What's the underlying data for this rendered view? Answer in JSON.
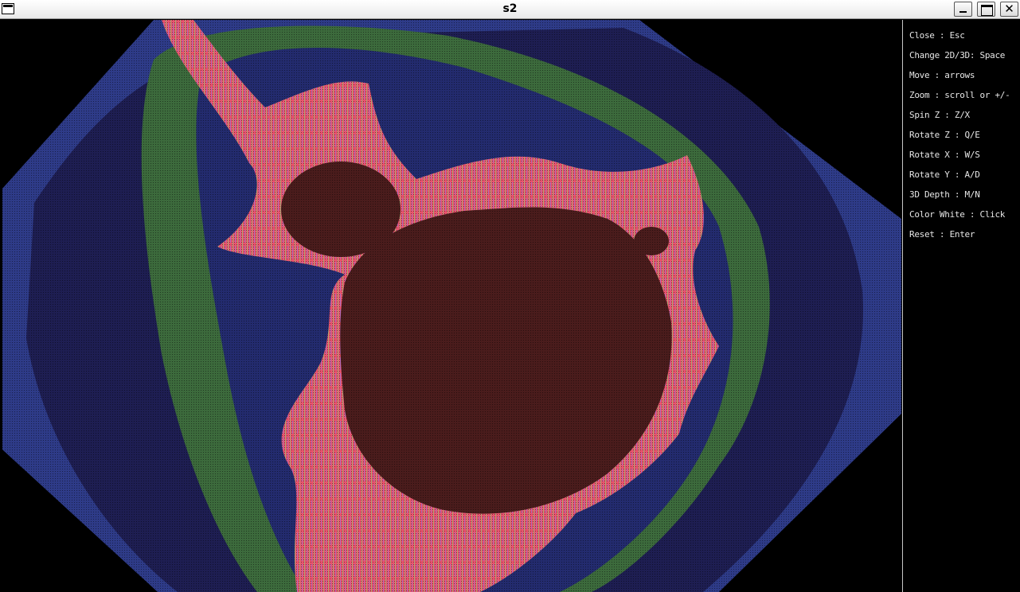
{
  "window": {
    "title": "s2"
  },
  "controls": {
    "close": "Close : Esc",
    "change_mode": "Change 2D/3D: Space",
    "move": "Move : arrows",
    "zoom": "Zoom : scroll or +/-",
    "spin_z": "Spin Z : Z/X",
    "rotate_z": "Rotate Z : Q/E",
    "rotate_x": "Rotate X : W/S",
    "rotate_y": "Rotate Y : A/D",
    "depth_3d": "3D Depth : M/N",
    "color_white": "Color White : Click",
    "reset": "Reset : Enter"
  },
  "colors": {
    "background": "#000000",
    "outer_band": "#2e3b88",
    "dark_band": "#1e1e52",
    "green_band": "#3c6a3c",
    "mid_band": "#232b6e",
    "edge_pink": "#e8556e",
    "interior": "#4a1c1c"
  }
}
